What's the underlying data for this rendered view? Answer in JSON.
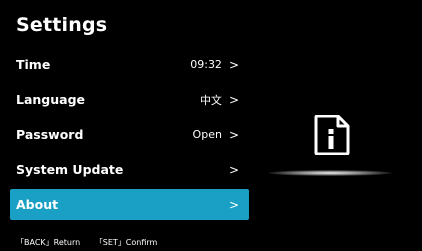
{
  "screen": {
    "title": "Settings"
  },
  "menu": {
    "items": [
      {
        "label": "Time",
        "value": "09:32",
        "chevron": ">",
        "selected": false
      },
      {
        "label": "Language",
        "value": "中文",
        "chevron": ">",
        "selected": false
      },
      {
        "label": "Password",
        "value": "Open",
        "chevron": ">",
        "selected": false
      },
      {
        "label": "System Update",
        "value": "",
        "chevron": ">",
        "selected": false
      },
      {
        "label": "About",
        "value": "",
        "chevron": ">",
        "selected": true
      }
    ]
  },
  "footer": {
    "back_hint": "「BACK」Return",
    "set_hint": "「SET」Confirm"
  },
  "preview": {
    "icon": "info-document-icon"
  },
  "colors": {
    "background": "#000000",
    "selection": "#1aa0c4",
    "text": "#ffffff"
  }
}
